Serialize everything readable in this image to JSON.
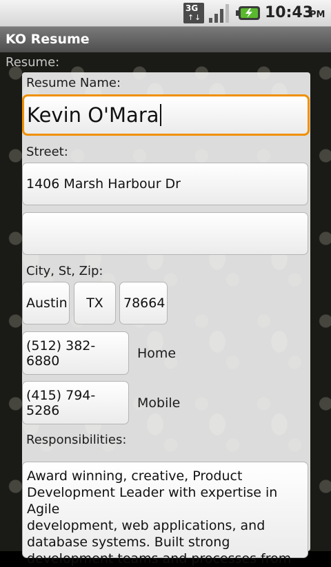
{
  "status_bar": {
    "network": "3G",
    "time": "10:43",
    "ampm": "PM",
    "icons": [
      "3g-data-icon",
      "signal-strength-icon",
      "battery-charging-icon"
    ]
  },
  "app": {
    "title": "KO Resume"
  },
  "form": {
    "section_label": "Resume:",
    "resume_name_label": "Resume Name:",
    "resume_name_value": "Kevin O'Mara",
    "street_label": "Street:",
    "street1_value": "1406 Marsh Harbour Dr",
    "street2_value": "",
    "city_label": "City, St, Zip:",
    "city_value": "Austin",
    "state_value": "TX",
    "zip_value": "78664",
    "phone_home_value": "(512) 382-6880",
    "phone_home_label": "Home",
    "phone_mobile_value": "(415) 794-5286",
    "phone_mobile_label": "Mobile",
    "responsibilities_label": "Responsibilities:",
    "responsibilities_lines": [
      "Award winning, creative, Product",
      "Development Leader with expertise in Agile",
      "development, web applications, and",
      "database systems.  Built strong",
      "development teams and processes from"
    ]
  },
  "colors": {
    "focus_accent": "#f09000",
    "title_bar": "#5e5e5e"
  }
}
